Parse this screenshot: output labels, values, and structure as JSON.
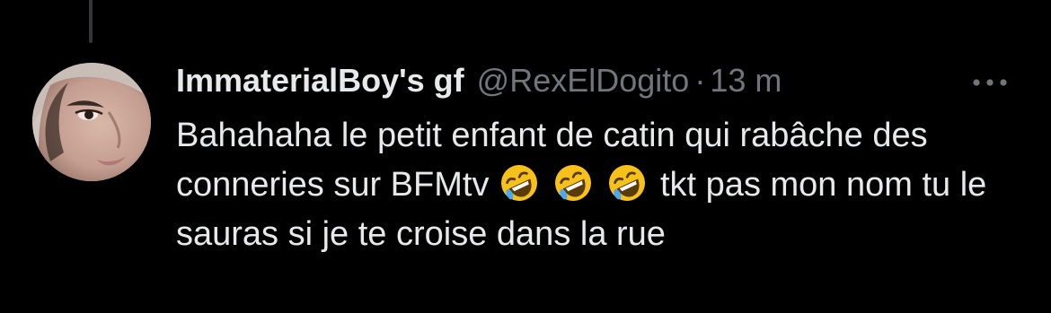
{
  "tweet": {
    "display_name": "ImmaterialBoy's gf",
    "handle": "@RexElDogito",
    "separator": "·",
    "time": "13 m",
    "text_part1": "Bahahaha le petit enfant de catin qui rabâche des conneries sur BFMtv ",
    "emojis": [
      "rolling-on-floor-laughing",
      "rolling-on-floor-laughing",
      "rolling-on-floor-laughing"
    ],
    "text_part2": "tkt pas mon nom tu le sauras si je te croise dans la rue"
  },
  "icons": {
    "more": "more-horizontal-icon"
  },
  "colors": {
    "background": "#000000",
    "primary_text": "#e7e9ea",
    "secondary_text": "#71767b",
    "thread_line": "#333639"
  }
}
